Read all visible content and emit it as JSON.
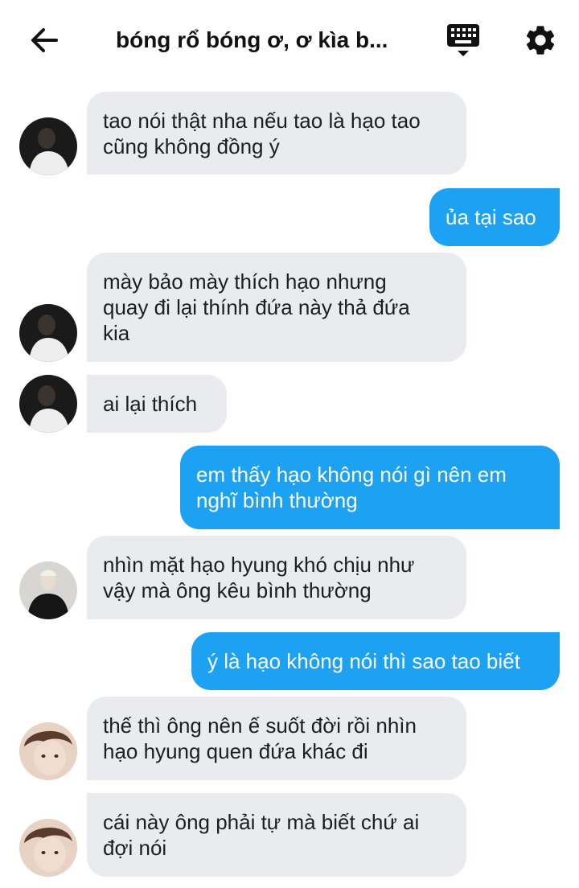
{
  "header": {
    "title": "bóng rổ bóng ơ, ơ kìa b...",
    "back_icon": "arrow-left-icon",
    "keyboard_icon": "keyboard-icon",
    "settings_icon": "gear-icon"
  },
  "colors": {
    "incoming_bubble": "#e9ebee",
    "outgoing_bubble": "#1da1f2",
    "outgoing_text": "#ffffff"
  },
  "messages": [
    {
      "direction": "in",
      "text": "tao nói thật nha nếu tao là hạo tao\ncũng không đồng ý"
    },
    {
      "direction": "out",
      "text": "ủa tại sao"
    },
    {
      "direction": "in",
      "text": "mày bảo mày thích hạo nhưng\nquay đi lại thính đứa này thả đứa\nkia"
    },
    {
      "direction": "in",
      "text": "ai lại thích"
    },
    {
      "direction": "out",
      "text": "em thấy hạo không nói gì nên em\nnghĩ bình thường"
    },
    {
      "direction": "in",
      "text": "nhìn mặt hạo hyung khó chịu như\nvậy mà ông kêu bình thường"
    },
    {
      "direction": "out",
      "text": "ý là hạo không nói thì sao tao biết"
    },
    {
      "direction": "in",
      "text": "thế thì ông nên ế suốt đời rồi nhìn\nhạo hyung quen đứa khác đi"
    },
    {
      "direction": "in",
      "text": "cái này ông phải tự mà biết chứ ai\nđợi nói"
    }
  ]
}
